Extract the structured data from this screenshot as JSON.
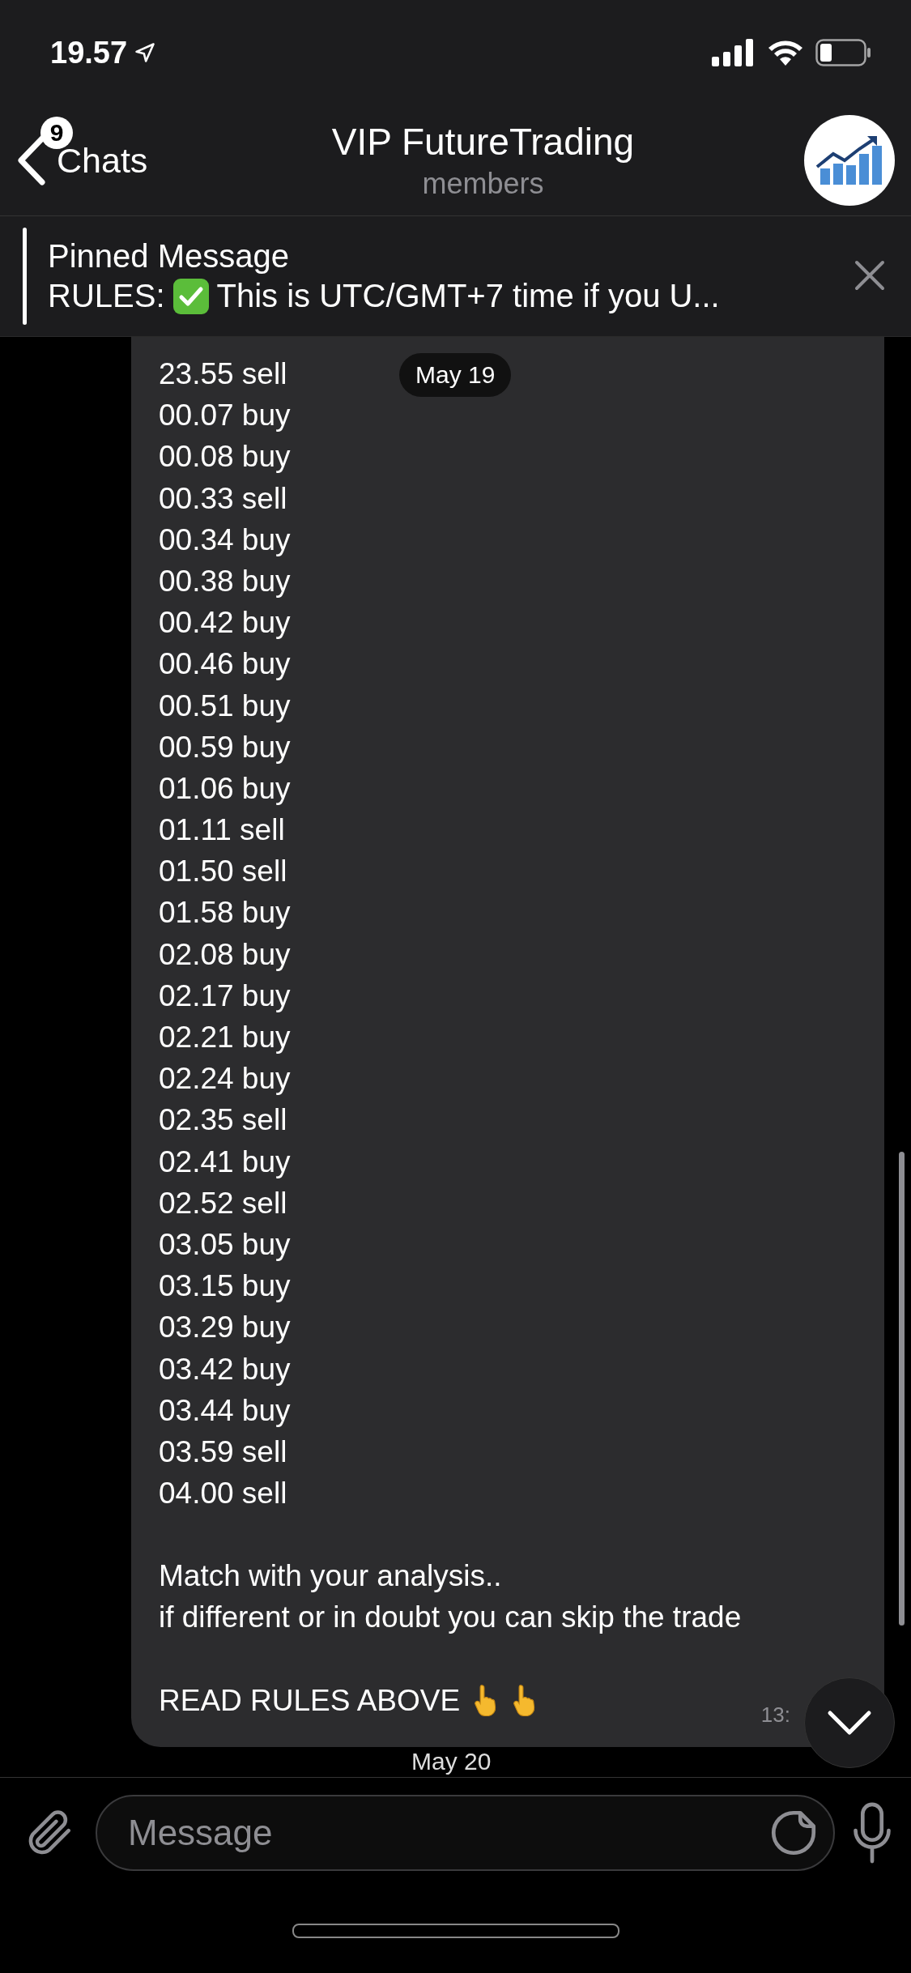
{
  "status_bar": {
    "time": "19.57"
  },
  "header": {
    "back_label": "Chats",
    "unread_badge": "9",
    "title": "VIP FutureTrading",
    "subtitle": "members"
  },
  "pinned": {
    "title": "Pinned Message",
    "text_before": "RULES:",
    "text_after": "This is UTC/GMT+7 time if you U..."
  },
  "date_pill": "May 19",
  "message": {
    "lines": [
      "23.55 sell",
      "00.07 buy",
      "00.08 buy",
      "00.33 sell",
      "00.34 buy",
      "00.38 buy",
      "00.42 buy",
      "00.46 buy",
      "00.51 buy",
      "00.59 buy",
      "01.06 buy",
      "01.11 sell",
      "01.50 sell",
      "01.58 buy",
      "02.08 buy",
      "02.17 buy",
      "02.21 buy",
      "02.24 buy",
      "02.35 sell",
      "02.41 buy",
      "02.52 sell",
      "03.05 buy",
      "03.15 buy",
      "03.29 buy",
      "03.42 buy",
      "03.44 buy",
      "03.59 sell",
      "04.00 sell"
    ],
    "note_lines": [
      "Match with your analysis..",
      "if different or in doubt you can skip the trade"
    ],
    "closing": "READ RULES ABOVE",
    "time": "13:"
  },
  "next_date": "May 20",
  "composer": {
    "placeholder": "Message"
  }
}
